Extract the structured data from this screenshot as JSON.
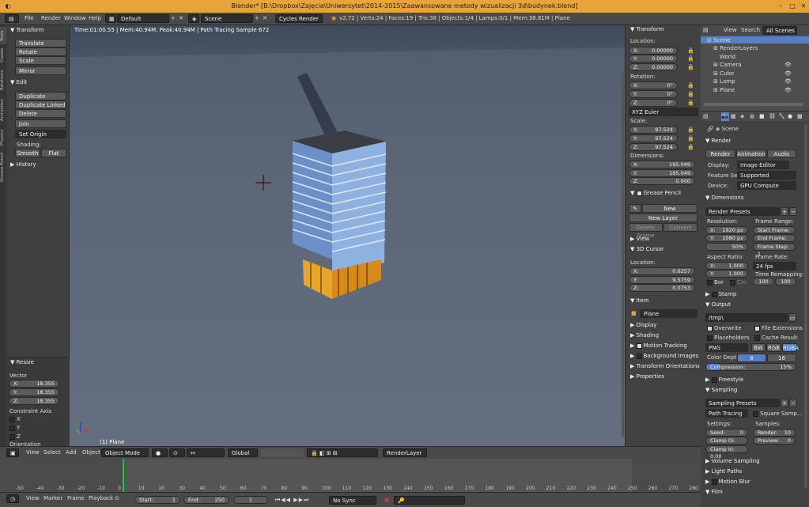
{
  "window": {
    "title": "Blender* [B:\\Dropbox\\Zajęcia\\Uniwersytet\\2014-2015\\Zaawansowane metody wizualizacji 3d\\budynek.blend]"
  },
  "topbar": {
    "menus": [
      "File",
      "Render",
      "Window",
      "Help"
    ],
    "layout": "Default",
    "scene": "Scene",
    "engine": "Cycles Render",
    "stats": "v2.72 | Verts:24 | Faces:19 | Tris:38 | Objects:1/4 | Lamps:0/1 | Mem:38.81M | Plane"
  },
  "toolshelf": {
    "tabs": [
      "Tools",
      "Create",
      "Relations",
      "Animation",
      "Physics",
      "Grease Pencil"
    ],
    "transform_header": "Transform",
    "translate": "Translate",
    "rotate": "Rotate",
    "scale": "Scale",
    "mirror": "Mirror",
    "edit_header": "Edit",
    "duplicate": "Duplicate",
    "duplicate_linked": "Duplicate Linked",
    "delete": "Delete",
    "join": "Join",
    "set_origin": "Set Origin",
    "shading_label": "Shading:",
    "smooth": "Smooth",
    "flat": "Flat",
    "history_header": "History"
  },
  "operator": {
    "header": "Resize",
    "vector_label": "Vector",
    "x": "18.355",
    "y": "18.355",
    "z": "18.355",
    "constraint_label": "Constraint Axis",
    "ax_x": "X",
    "ax_y": "Y",
    "ax_z": "Z",
    "orientation": "Orientation"
  },
  "viewport": {
    "info": "Time:01:00.55 | Mem:40.94M, Peak:40.94M | Path Tracing Sample 672",
    "object_label": "(1) Plane"
  },
  "vpheader": {
    "menus": [
      "View",
      "Select",
      "Add",
      "Object"
    ],
    "mode": "Object Mode",
    "orientation": "Global",
    "renderlayer": "RenderLayer"
  },
  "npanel": {
    "transform": "Transform",
    "location": "Location:",
    "loc_x": "0.00000",
    "loc_y": "0.00000",
    "loc_z": "0.00000",
    "rotation": "Rotation:",
    "rot_x": "0°",
    "rot_y": "0°",
    "rot_z": "0°",
    "euler": "XYZ Euler",
    "scale": "Scale:",
    "sc_x": "97.524",
    "sc_y": "97.524",
    "sc_z": "97.524",
    "dimensions": "Dimensions:",
    "dim_x": "195.049",
    "dim_y": "195.049",
    "dim_z": "0.000",
    "grease_pencil": "Grease Pencil",
    "new": "New",
    "new_layer": "New Layer",
    "delete_frame": "Delete Frame",
    "convert": "Convert",
    "view": "View",
    "cursor": "3D Cursor",
    "cursor_loc": "Location:",
    "cur_x": "0.6257",
    "cur_y": "9.5759",
    "cur_z": "0.0753",
    "item": "Item",
    "item_name": "Plane",
    "display": "Display",
    "shading": "Shading",
    "motion_tracking": "Motion Tracking",
    "background_images": "Background Images",
    "transform_orientations": "Transform Orientations",
    "properties": "Properties",
    "x": "X:",
    "y": "Y:",
    "z": "Z:"
  },
  "outliner": {
    "menus": [
      "View",
      "Search"
    ],
    "filter": "All Scenes",
    "items": [
      "Scene",
      "RenderLayers",
      "World",
      "Camera",
      "Cube",
      "Lamp",
      "Plane"
    ]
  },
  "props": {
    "scene": "Scene",
    "render_header": "Render",
    "render_btn": "Render",
    "animation_btn": "Animation",
    "audio_btn": "Audio",
    "display_label": "Display:",
    "display_val": "Image Editor",
    "feature_label": "Feature Set:",
    "feature_val": "Supported",
    "device_label": "Device:",
    "device_val": "GPU Compute",
    "dimensions_header": "Dimensions",
    "render_presets": "Render Presets",
    "resolution": "Resolution:",
    "res_x": "1920 px",
    "res_y": "1080 px",
    "res_pct": "50%",
    "frame_range": "Frame Range:",
    "start_frame": "Start Frame: 1",
    "end_frame": "End Frame: 250",
    "frame_step": "Frame Step: 1",
    "aspect": "Aspect Ratio:",
    "asp_x": "1.000",
    "asp_y": "1.000",
    "frame_rate": "Frame Rate:",
    "fps": "24 fps",
    "time_remap": "Time Remapping:",
    "remap_old": "100",
    "remap_new": "100",
    "bor": "Bor",
    "crop": "Cro",
    "stamp": "Stamp",
    "output_header": "Output",
    "output_path": "/tmp\\",
    "overwrite": "Overwrite",
    "file_ext": "File Extensions",
    "placeholders": "Placeholders",
    "cache_result": "Cache Result",
    "format": "PNG",
    "bw": "BW",
    "rgb": "RGB",
    "rgba": "RGBA",
    "color_depth": "Color Depth:",
    "depth8": "8",
    "depth16": "16",
    "compression": "Compression:",
    "compression_val": "15%",
    "freestyle": "Freestyle",
    "sampling_header": "Sampling",
    "sampling_presets": "Sampling Presets",
    "path_tracing": "Path Tracing",
    "square_samples": "Square Samp...",
    "settings": "Settings:",
    "samples": "Samples:",
    "seed": "Seed:",
    "seed_val": "0",
    "clamp_direct": "Clamp Di: 0.00",
    "clamp_indirect": "Clamp In: 0.00",
    "render_samples": "Render:",
    "render_samples_val": "10",
    "preview_samples": "Preview:",
    "preview_samples_val": "0",
    "volume_sampling": "Volume Sampling",
    "light_paths": "Light Paths",
    "motion_blur": "Motion Blur",
    "film": "Film"
  },
  "timeline": {
    "ticks": [
      "-50",
      "-40",
      "-30",
      "-20",
      "-10",
      "0",
      "10",
      "20",
      "30",
      "40",
      "50",
      "60",
      "70",
      "80",
      "90",
      "100",
      "110",
      "120",
      "130",
      "140",
      "150",
      "160",
      "170",
      "180",
      "190",
      "200",
      "210",
      "220",
      "230",
      "240",
      "250",
      "260",
      "270",
      "280"
    ],
    "menus": [
      "View",
      "Marker",
      "Frame",
      "Playback"
    ],
    "start": "Start:",
    "start_val": "1",
    "end": "End:",
    "end_val": "250",
    "current": "1",
    "sync": "No Sync"
  },
  "colors": {
    "accent": "#5680c2",
    "title_bar": "#e8a33a",
    "timeline_cursor": "#22c24a"
  }
}
